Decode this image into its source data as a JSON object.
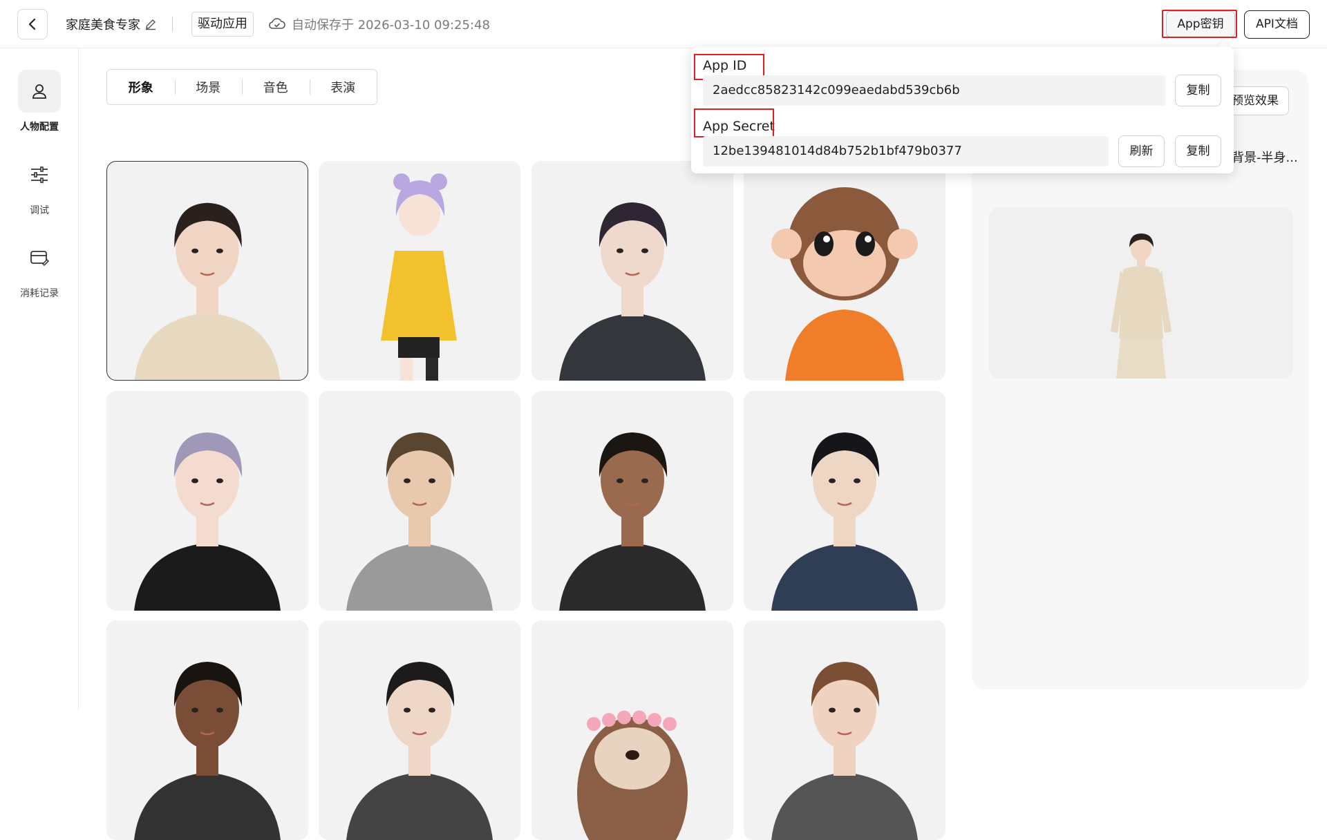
{
  "header": {
    "app_name": "家庭美食专家",
    "drive_app_label": "驱动应用",
    "autosave_text": "自动保存于 2026-03-10 09:25:48",
    "app_key_label": "App密钥",
    "api_doc_label": "API文档"
  },
  "sidebar": {
    "items": [
      {
        "label": "人物配置",
        "icon": "person-icon",
        "active": true
      },
      {
        "label": "调试",
        "icon": "sliders-icon",
        "active": false
      },
      {
        "label": "消耗记录",
        "icon": "card-icon",
        "active": false
      }
    ]
  },
  "tabs": [
    {
      "label": "形象",
      "active": true
    },
    {
      "label": "场景",
      "active": false
    },
    {
      "label": "音色",
      "active": false
    },
    {
      "label": "表演",
      "active": false
    }
  ],
  "right_panel": {
    "preview_button": "预览效果",
    "background_label": "背景-半身..."
  },
  "popover": {
    "app_id_label": "App ID",
    "app_id_value": "2aedcc85823142c099eaedabd539cb6b",
    "app_secret_label": "App Secret",
    "app_secret_value": "12be139481014d84b752b1bf479b0377",
    "copy_label": "复制",
    "refresh_label": "刷新"
  },
  "avatars": [
    {
      "kind": "woman-short-hair",
      "hair": "#2a211c",
      "skin": "#f0d5c4",
      "top": "#e6d9c0",
      "selected": true
    },
    {
      "kind": "anime-girl",
      "hair": "#b8a7e0",
      "skin": "#f7e2d8",
      "top": "#f2c12e",
      "selected": false
    },
    {
      "kind": "man-curly",
      "hair": "#2e2632",
      "skin": "#efd8cc",
      "top": "#33363a",
      "selected": false
    },
    {
      "kind": "monkey",
      "hair": "#8b5a3c",
      "skin": "#f3c9b0",
      "top": "#f07d2a",
      "selected": false
    },
    {
      "kind": "woman-lavender",
      "hair": "#9f98b8",
      "skin": "#f3dbd0",
      "top": "#1b1b1b",
      "selected": false
    },
    {
      "kind": "man-suit",
      "hair": "#5a4530",
      "skin": "#e9c9ad",
      "top": "#9a9a9a",
      "selected": false
    },
    {
      "kind": "woman-blazer",
      "hair": "#1c1612",
      "skin": "#9a6a4e",
      "top": "#2a2a2a",
      "selected": false
    },
    {
      "kind": "man-navy",
      "hair": "#16161a",
      "skin": "#eed6c4",
      "top": "#2f3e55",
      "selected": false
    },
    {
      "kind": "woman-curly",
      "hair": "#1a1410",
      "skin": "#7a4e36",
      "top": "#333",
      "selected": false
    },
    {
      "kind": "woman-bob",
      "hair": "#1c1a1a",
      "skin": "#efd7c8",
      "top": "#444",
      "selected": false
    },
    {
      "kind": "otter",
      "hair": "#8a5f45",
      "skin": "#e8d2c0",
      "top": "#f4a7b9",
      "selected": false
    },
    {
      "kind": "woman-brown",
      "hair": "#7a4f33",
      "skin": "#efd3c0",
      "top": "#555",
      "selected": false
    }
  ]
}
